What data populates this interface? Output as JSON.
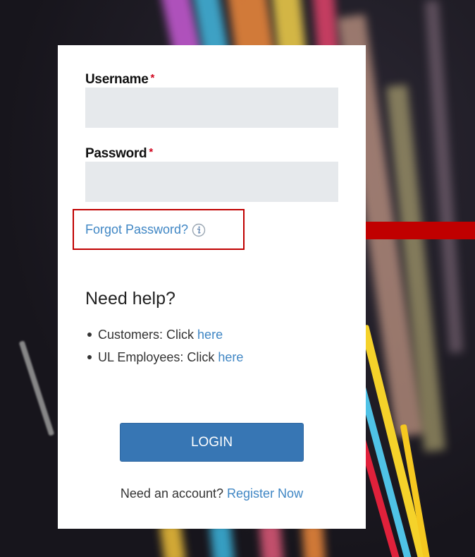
{
  "form": {
    "username_label": "Username",
    "password_label": "Password",
    "required_mark": "*",
    "username_value": "",
    "password_value": "",
    "forgot_password_label": "Forgot Password?",
    "info_icon": "info-circle-icon"
  },
  "help": {
    "title": "Need help?",
    "items": [
      {
        "prefix": "Customers: Click",
        "link": "here"
      },
      {
        "prefix": "UL Employees: Click",
        "link": "here"
      }
    ]
  },
  "login_button_label": "LOGIN",
  "register": {
    "prefix": "Need an account?",
    "link": "Register Now"
  },
  "colors": {
    "link": "#3f86c4",
    "button": "#3776b4",
    "highlight": "#c00000",
    "required": "#d0021b",
    "input_bg": "#e6e9ec"
  }
}
